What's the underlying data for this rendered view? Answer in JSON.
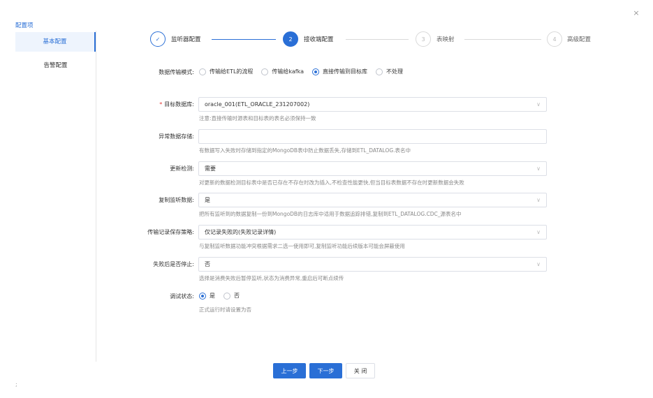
{
  "close_icon": "×",
  "sidebar": {
    "title": "配置项",
    "items": [
      {
        "label": "基本配置"
      },
      {
        "label": "告警配置"
      }
    ]
  },
  "steps": [
    {
      "index": "✓",
      "label": "监听器配置",
      "state": "done"
    },
    {
      "index": "2",
      "label": "接收端配置",
      "state": "active"
    },
    {
      "index": "3",
      "label": "表映射",
      "state": "pending"
    },
    {
      "index": "4",
      "label": "高级配置",
      "state": "pending"
    }
  ],
  "form": {
    "mode": {
      "label": "数据传输模式:",
      "options": [
        "传输给ETL的流程",
        "传输给kafka",
        "直接传输到目标库",
        "不处理"
      ],
      "selected": "直接传输到目标库"
    },
    "target_db": {
      "label": "目标数据库:",
      "value": "oracle_001(ETL_ORACLE_231207002)",
      "hint": "注意:直接传输时源表和目标表的表名必须保持一致"
    },
    "error_storage": {
      "label": "异常数据存储:",
      "value": "",
      "hint": "有数据写入失败时存储到指定的MongoDB表中防止数据丢失,存储到ETL_DATALOG.表名中"
    },
    "update_check": {
      "label": "更新检测:",
      "value": "需要",
      "hint": "对更新的数据检测目标表中是否已存在不存在时改为插入,不检查性能更快,但当目标表数据不存在时更新数据会失败"
    },
    "copy_listen": {
      "label": "复制监听数据:",
      "value": "是",
      "hint": "把所有监听到的数据复制一份到MongoDB的日志库中适用于数据追踪排错,复制到ETL_DATALOG.CDC_源表名中"
    },
    "log_policy": {
      "label": "传输记录保存策略:",
      "value": "仅记录失败的(失败记录详情)",
      "hint": "与复制监听数据功能冲突根据需求二选一使用即可,复制监听功能后续版本可能会屏蔽使用"
    },
    "stop_on_fail": {
      "label": "失败后是否停止:",
      "value": "否",
      "hint": "选择是消费失败后暂停监听,状态为消费异常,重启后可断点续传"
    },
    "debug": {
      "label": "调试状态:",
      "options": [
        "是",
        "否"
      ],
      "selected": "是",
      "hint": "正式运行时请设置为否"
    }
  },
  "buttons": {
    "prev": "上一步",
    "next": "下一步",
    "close": "关 闭"
  },
  "corner_mark": ";",
  "accent": "#2a6fd6"
}
